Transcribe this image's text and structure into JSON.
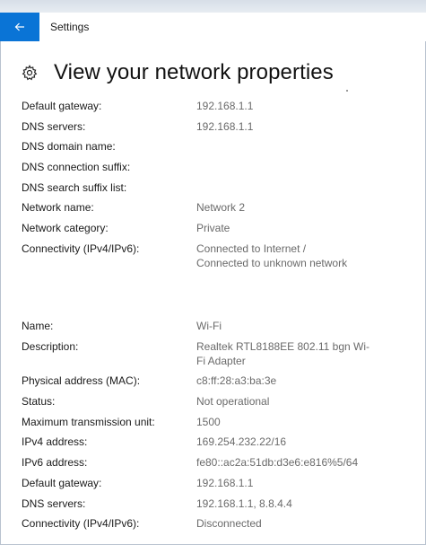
{
  "header": {
    "back_label": "back",
    "app_title": "Settings"
  },
  "page": {
    "title": "View your network properties",
    "title_icon": "gear-icon"
  },
  "accent_color": "#0a74d6",
  "network_properties": [
    {
      "label": "Default gateway:",
      "value": "192.168.1.1"
    },
    {
      "label": "DNS servers:",
      "value": "192.168.1.1"
    },
    {
      "label": "DNS domain name:",
      "value": ""
    },
    {
      "label": "DNS connection suffix:",
      "value": ""
    },
    {
      "label": "DNS search suffix list:",
      "value": ""
    },
    {
      "label": "Network name:",
      "value": "Network  2"
    },
    {
      "label": "Network category:",
      "value": "Private"
    },
    {
      "label": "Connectivity (IPv4/IPv6):",
      "value": "Connected to Internet /\nConnected to unknown network"
    }
  ],
  "adapter_properties": [
    {
      "label": "Name:",
      "value": "Wi-Fi"
    },
    {
      "label": "Description:",
      "value": "Realtek RTL8188EE 802.11 bgn Wi-\nFi Adapter"
    },
    {
      "label": "Physical address (MAC):",
      "value": "c8:ff:28:a3:ba:3e"
    },
    {
      "label": "Status:",
      "value": "Not operational"
    },
    {
      "label": "Maximum transmission unit:",
      "value": "1500"
    },
    {
      "label": "IPv4 address:",
      "value": "169.254.232.22/16"
    },
    {
      "label": "IPv6 address:",
      "value": "fe80::ac2a:51db:d3e6:e816%5/64"
    },
    {
      "label": "Default gateway:",
      "value": "192.168.1.1"
    },
    {
      "label": "DNS servers:",
      "value": "192.168.1.1, 8.8.4.4"
    },
    {
      "label": "Connectivity (IPv4/IPv6):",
      "value": "Disconnected"
    }
  ]
}
